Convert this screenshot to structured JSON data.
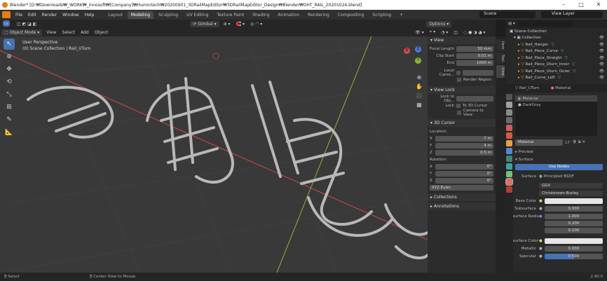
{
  "titlebar": {
    "title": "Blender* [D:₩Downloads₩_WORK₩_innosoft₩[Company]₩Humintech₩20200901_3DRailMapEditor₩3DRailMapEditor_Design₩Blender₩OHT_RAIL_20201024.blend]"
  },
  "menus": [
    "File",
    "Edit",
    "Render",
    "Window",
    "Help"
  ],
  "workspace_tabs": [
    "Layout",
    "Modeling",
    "Sculpting",
    "UV Editing",
    "Texture Paint",
    "Shading",
    "Animation",
    "Rendering",
    "Compositing",
    "Scripting"
  ],
  "active_tab": "Modeling",
  "scene": {
    "label": "Scene",
    "view_layer": "View Layer"
  },
  "viewport_header": {
    "mode": "Object Mode",
    "menus": [
      "View",
      "Select",
      "Add",
      "Object"
    ],
    "transform_orientation": "Gimbal",
    "options": "Options"
  },
  "viewport": {
    "perspective": "User Perspective",
    "collection": "(0) Scene Collection | Rail_UTurn"
  },
  "axes": {
    "x": "X",
    "y": "Y",
    "z": "Z"
  },
  "npanel": {
    "view_section": "View",
    "focal_length_label": "Focal Length",
    "focal_length": "50 mm",
    "clip_start_label": "Clip Start",
    "clip_start": "0.01 m",
    "end_label": "End",
    "end": "1000 m",
    "local_camera_label": "Local Came...",
    "render_region": "Render Region",
    "view_lock_section": "View Lock",
    "lock_to_object_label": "Lock to Obj...",
    "lock_label": "Lock",
    "to_3d_cursor": "To 3D Cursor",
    "camera_to_view": "Camera to View",
    "cursor_section": "3D Cursor",
    "location_label": "Location:",
    "loc_x": "-7 m",
    "loc_y": "4 m",
    "loc_z": "0.5 m",
    "rotation_label": "Rotation:",
    "rot_x": "0°",
    "rot_y": "0°",
    "rot_z": "0°",
    "rotation_mode": "XYZ Euler",
    "collections_section": "Collections",
    "annotations_section": "Annotations"
  },
  "side_tabs": [
    "Item",
    "Tool",
    "View"
  ],
  "outliner": {
    "root": "Scene Collection",
    "collection": "Collection",
    "items": [
      "Rail_Hanger",
      "Rail_Piece_Curve",
      "Rail_Piece_Straight",
      "Rail_Piece_Uturn_Inner",
      "Rail_Piece_Uturn_Outer",
      "Rail_Curve_Left"
    ]
  },
  "properties": {
    "object_name": "Rail_UTurn",
    "tab_name": "Material",
    "slots": [
      "Material",
      "DarkGray"
    ],
    "material_name": "Material",
    "user_count": "17",
    "preview_section": "Preview",
    "surface_section": "Surface",
    "use_nodes": "Use Nodes",
    "surface_label": "Surface",
    "surface_value": "Principled BSDF",
    "distribution": "GGX",
    "subsurface_method": "Christensen-Burley",
    "base_color_label": "Base Color",
    "subsurface_label": "Subsurface",
    "subsurface_value": "0.000",
    "subsurface_radius_label": "Subsurface Radiu",
    "radius_1": "1.000",
    "radius_2": "0.200",
    "radius_3": "0.100",
    "subsurface_color_label": "Subsurface Color",
    "metallic_label": "Metallic",
    "metallic_value": "0.000",
    "specular_label": "Specular",
    "specular_value": "0.500"
  },
  "statusbar": {
    "select": "Select",
    "center": "Center View to Mouse",
    "version": "2.90.0"
  },
  "colors": {
    "accent": "#4772b3",
    "viewport": "#393939",
    "x_axis": "#d04848",
    "y_axis": "#8ab43c",
    "z_axis": "#4b7bd8"
  }
}
